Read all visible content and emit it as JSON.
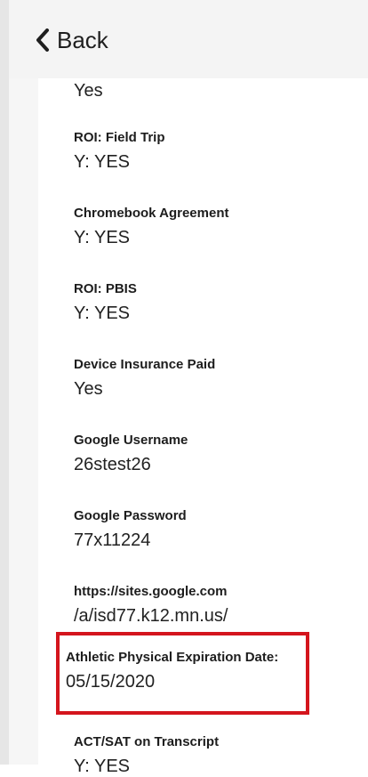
{
  "header": {
    "back_label": "Back"
  },
  "fields": [
    {
      "value": "Yes"
    },
    {
      "label": "ROI: Field Trip",
      "value": "Y: YES"
    },
    {
      "label": "Chromebook Agreement",
      "value": "Y: YES"
    },
    {
      "label": "ROI: PBIS",
      "value": "Y: YES"
    },
    {
      "label": "Device Insurance Paid",
      "value": "Yes"
    },
    {
      "label": "Google Username",
      "value": "26stest26"
    },
    {
      "label": "Google Password",
      "value": "77x11224"
    },
    {
      "label": "https://sites.google.com",
      "value": "/a/isd77.k12.mn.us/"
    },
    {
      "label": "Athletic Physical Expiration Date:",
      "value": "05/15/2020"
    },
    {
      "label": "ACT/SAT on Transcript",
      "value": "Y: YES"
    }
  ],
  "colors": {
    "highlight_border": "#d4151d"
  }
}
